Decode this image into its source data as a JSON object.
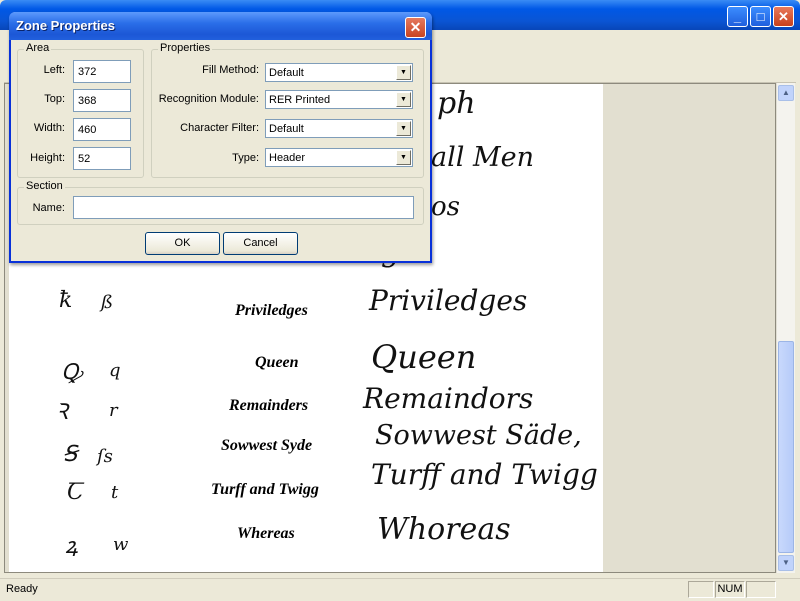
{
  "main_window": {
    "controls": {
      "minimize": "_",
      "maximize": "□",
      "close": "✕"
    }
  },
  "document": {
    "handwriting_top": [
      {
        "text": "ph"
      },
      {
        "text": "all Men"
      },
      {
        "text": "os"
      },
      {
        "text": "go"
      }
    ],
    "rows": [
      {
        "glyph_a": "ꝁ",
        "glyph_b": "ß",
        "printed": "Priviledges",
        "handwritten": "Priviledges"
      },
      {
        "glyph_a": "Ꝙ",
        "glyph_b": "q",
        "printed": "Queen",
        "handwritten": "Queen"
      },
      {
        "glyph_a": "Ꝛ",
        "glyph_b": "r",
        "printed": "Remainders",
        "handwritten": "Remaindors"
      },
      {
        "glyph_a": "Ꞩ",
        "glyph_b": "ſs",
        "printed": "Sowwest Syde",
        "handwritten": "Sowwest Säde,"
      },
      {
        "glyph_a": "Ꞇ",
        "glyph_b": "t",
        "printed": "Turff and Twigg",
        "handwritten": "Turff and Twigg"
      },
      {
        "glyph_a": "ꝝ",
        "glyph_b": "w",
        "printed": "Whereas",
        "handwritten": "Whoreas"
      }
    ]
  },
  "statusbar": {
    "status": "Ready",
    "num": "NUM"
  },
  "dialog": {
    "title": "Zone Properties",
    "close_label": "✕",
    "area": {
      "legend": "Area",
      "left_label": "Left:",
      "left_value": "372",
      "top_label": "Top:",
      "top_value": "368",
      "width_label": "Width:",
      "width_value": "460",
      "height_label": "Height:",
      "height_value": "52"
    },
    "properties": {
      "legend": "Properties",
      "fill_method_label": "Fill Method:",
      "fill_method_value": "Default",
      "recognition_label": "Recognition Module:",
      "recognition_value": "RER Printed",
      "char_filter_label": "Character Filter:",
      "char_filter_value": "Default",
      "type_label": "Type:",
      "type_value": "Header"
    },
    "section": {
      "legend": "Section",
      "name_label": "Name:",
      "name_value": ""
    },
    "ok_label": "OK",
    "cancel_label": "Cancel"
  }
}
